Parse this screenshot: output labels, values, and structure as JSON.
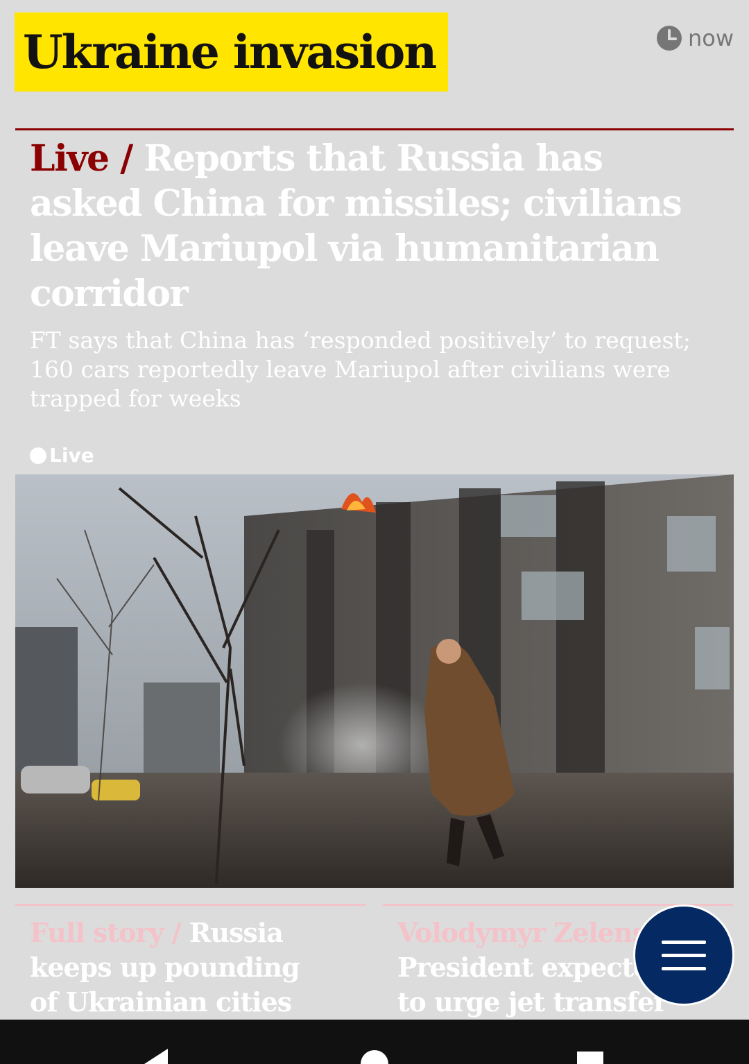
{
  "topic": {
    "label": "Ukraine invasion",
    "background": "#ffe500"
  },
  "timestamp": {
    "icon": "clock-icon",
    "label": "now"
  },
  "headline": {
    "kicker": "Live /",
    "text": "Reports that Russia has asked China for missiles; civilians leave Mariupol via humanitarian corridor",
    "kicker_color": "#8b0000"
  },
  "standfirst": "FT says that China has ‘responded positively’ to request; 160 cars reportedly leave Mariupol after civilians were trapped for weeks",
  "live_badge": {
    "label": "Live"
  },
  "cards": [
    {
      "kicker": "Full story /",
      "title": "Russia keeps up pounding of Ukrainian cities amid"
    },
    {
      "kicker": "Volodymyr Zelensky /",
      "title": "President expected to urge jet transfer in"
    }
  ],
  "menu_button": {
    "icon": "menu-icon",
    "color": "#052962"
  },
  "system_nav": {
    "back": "back-icon",
    "home": "home-icon",
    "recents": "recents-icon"
  }
}
